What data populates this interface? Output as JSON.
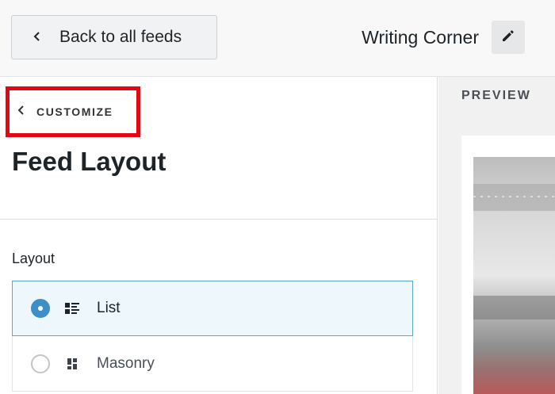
{
  "header": {
    "back_label": "Back to all feeds",
    "feed_title": "Writing Corner"
  },
  "panel": {
    "breadcrumb": "CUSTOMIZE",
    "title": "Feed Layout",
    "layout_heading": "Layout",
    "options": [
      {
        "label": "List",
        "selected": true,
        "icon": "list-icon"
      },
      {
        "label": "Masonry",
        "selected": false,
        "icon": "masonry-icon"
      }
    ]
  },
  "preview": {
    "label": "PREVIEW"
  },
  "colors": {
    "highlight_border": "#e30613",
    "radio_selected": "#3d8fc8",
    "selected_bg": "#eef7fb"
  }
}
